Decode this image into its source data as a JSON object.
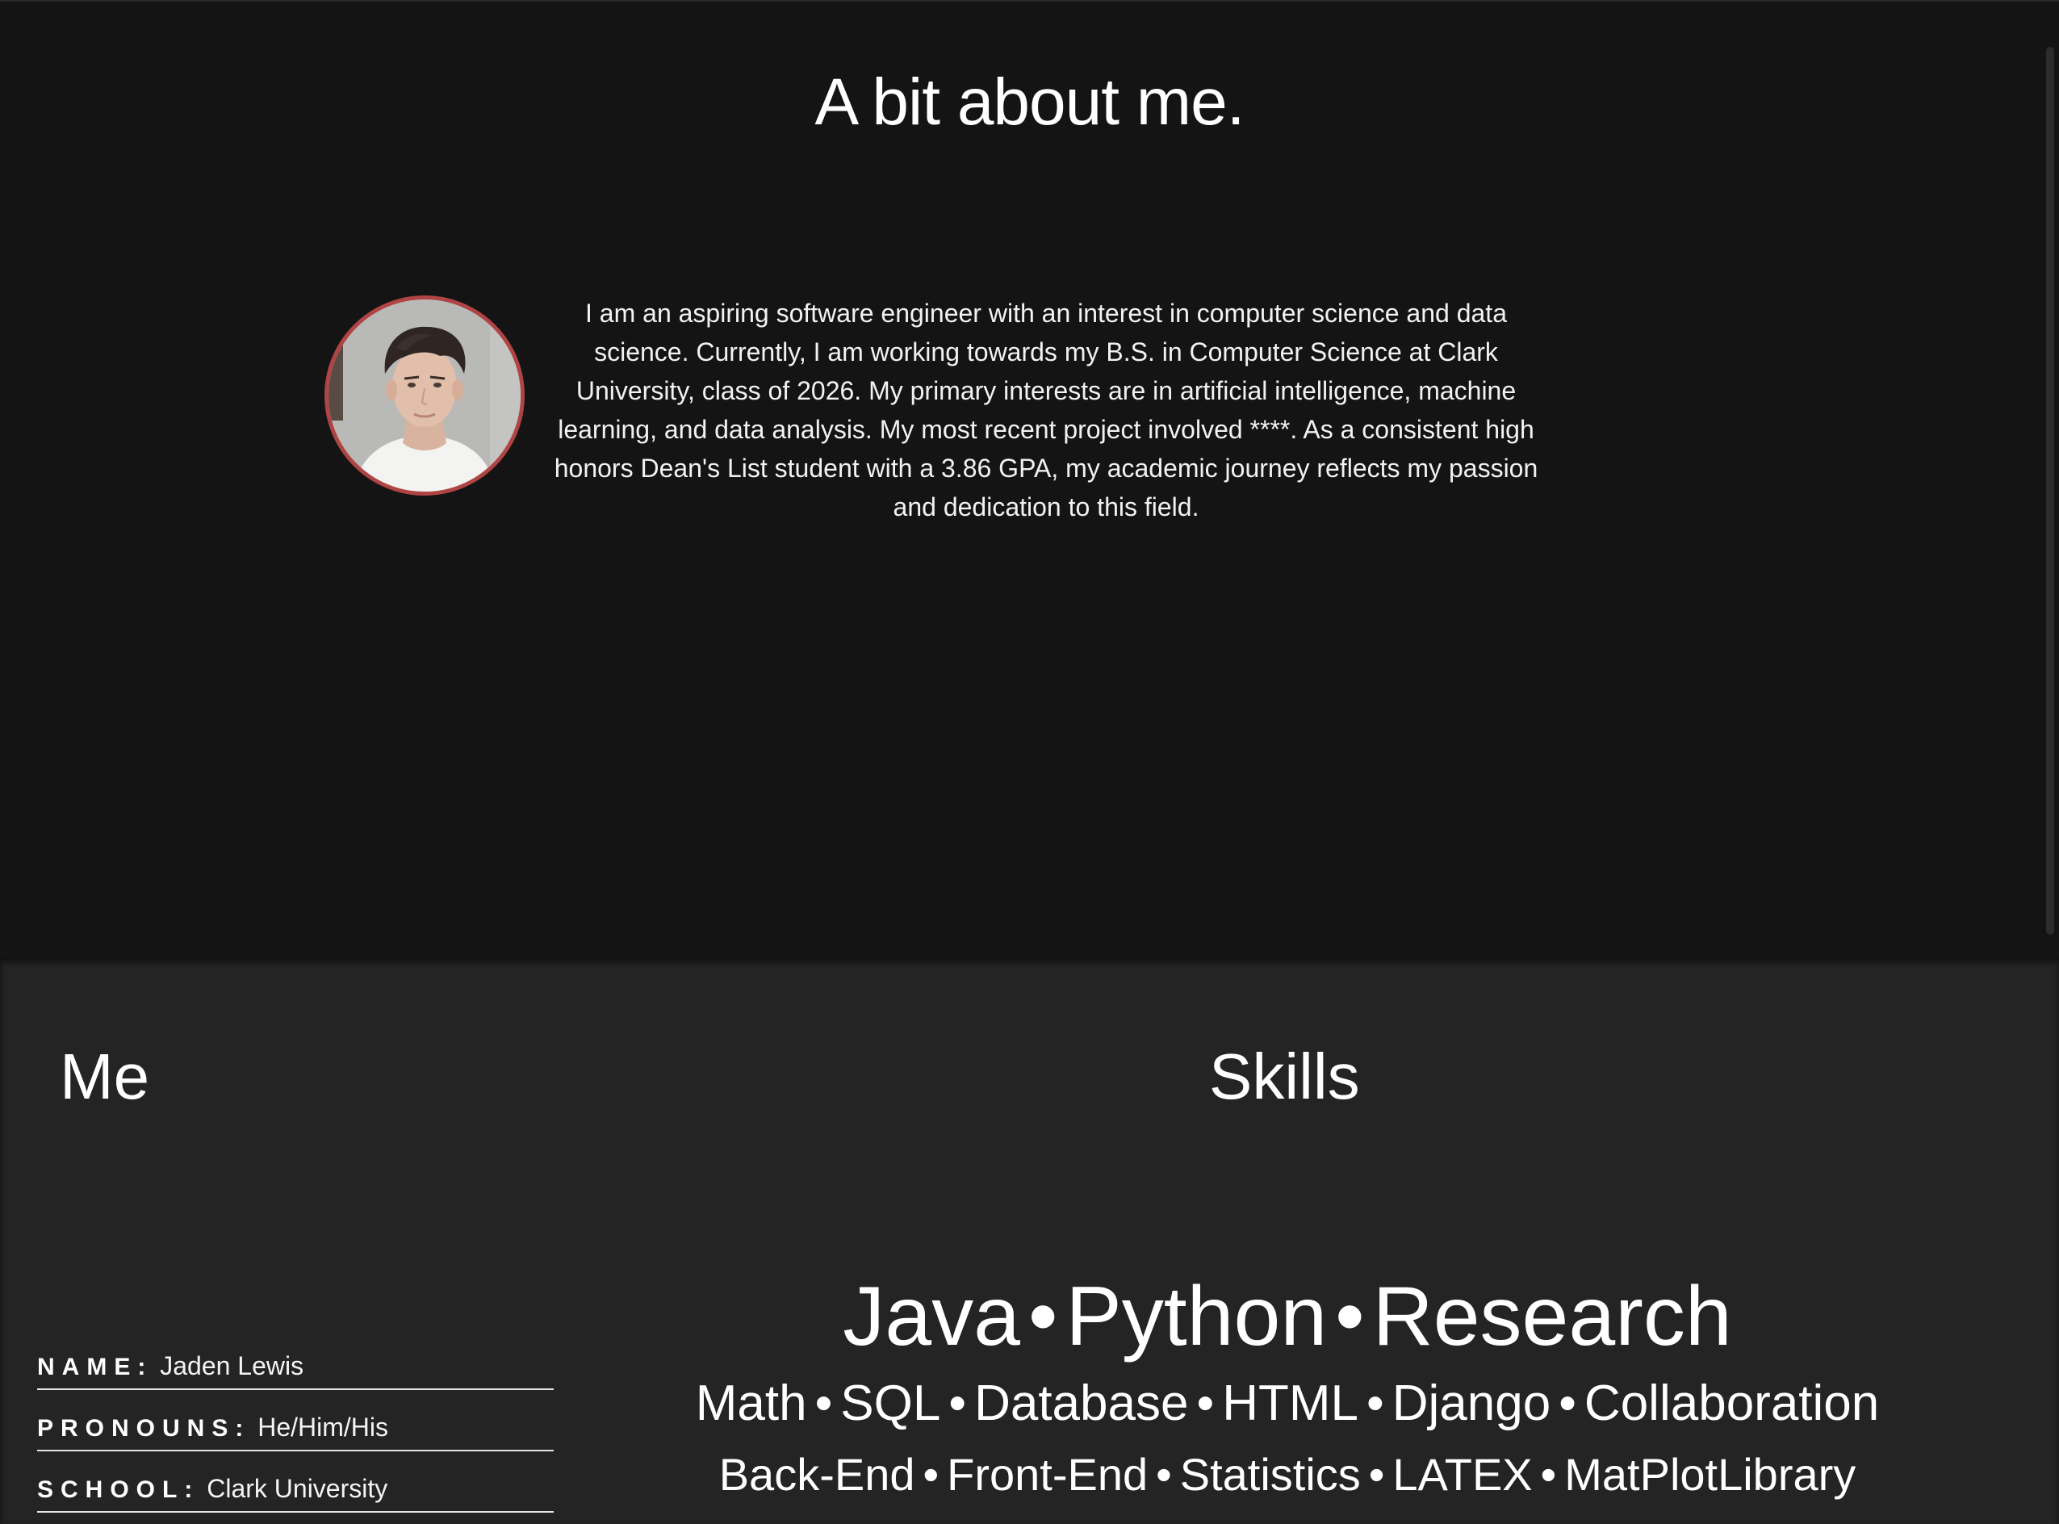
{
  "about": {
    "title": "A bit about me.",
    "bio": "I am an aspiring software engineer with an interest in computer science and data science. Currently, I am working towards my B.S. in Computer Science at Clark University, class of 2026. My primary interests are in artificial intelligence, machine learning, and data analysis. My most recent project involved ****. As a consistent high honors Dean's List student with a 3.86 GPA, my academic journey reflects my passion and dedication to this field.",
    "avatar_border_color": "#b04444"
  },
  "me": {
    "title": "Me",
    "items": [
      {
        "label": "NAME:",
        "value": "Jaden Lewis"
      },
      {
        "label": "PRONOUNS:",
        "value": "He/Him/His"
      },
      {
        "label": "SCHOOL:",
        "value": "Clark University"
      }
    ]
  },
  "skills": {
    "title": "Skills",
    "separator": "•",
    "line1": [
      "Java",
      "Python",
      "Research"
    ],
    "line2": [
      "Math",
      "SQL",
      "Database",
      "HTML",
      "Django",
      "Collaboration"
    ],
    "line3": [
      "Back-End",
      "Front-End",
      "Statistics",
      "LATEX",
      "MatPlotLibrary"
    ]
  },
  "colors": {
    "top_background": "#141414",
    "bottom_background": "#242424",
    "text": "#ffffff"
  }
}
